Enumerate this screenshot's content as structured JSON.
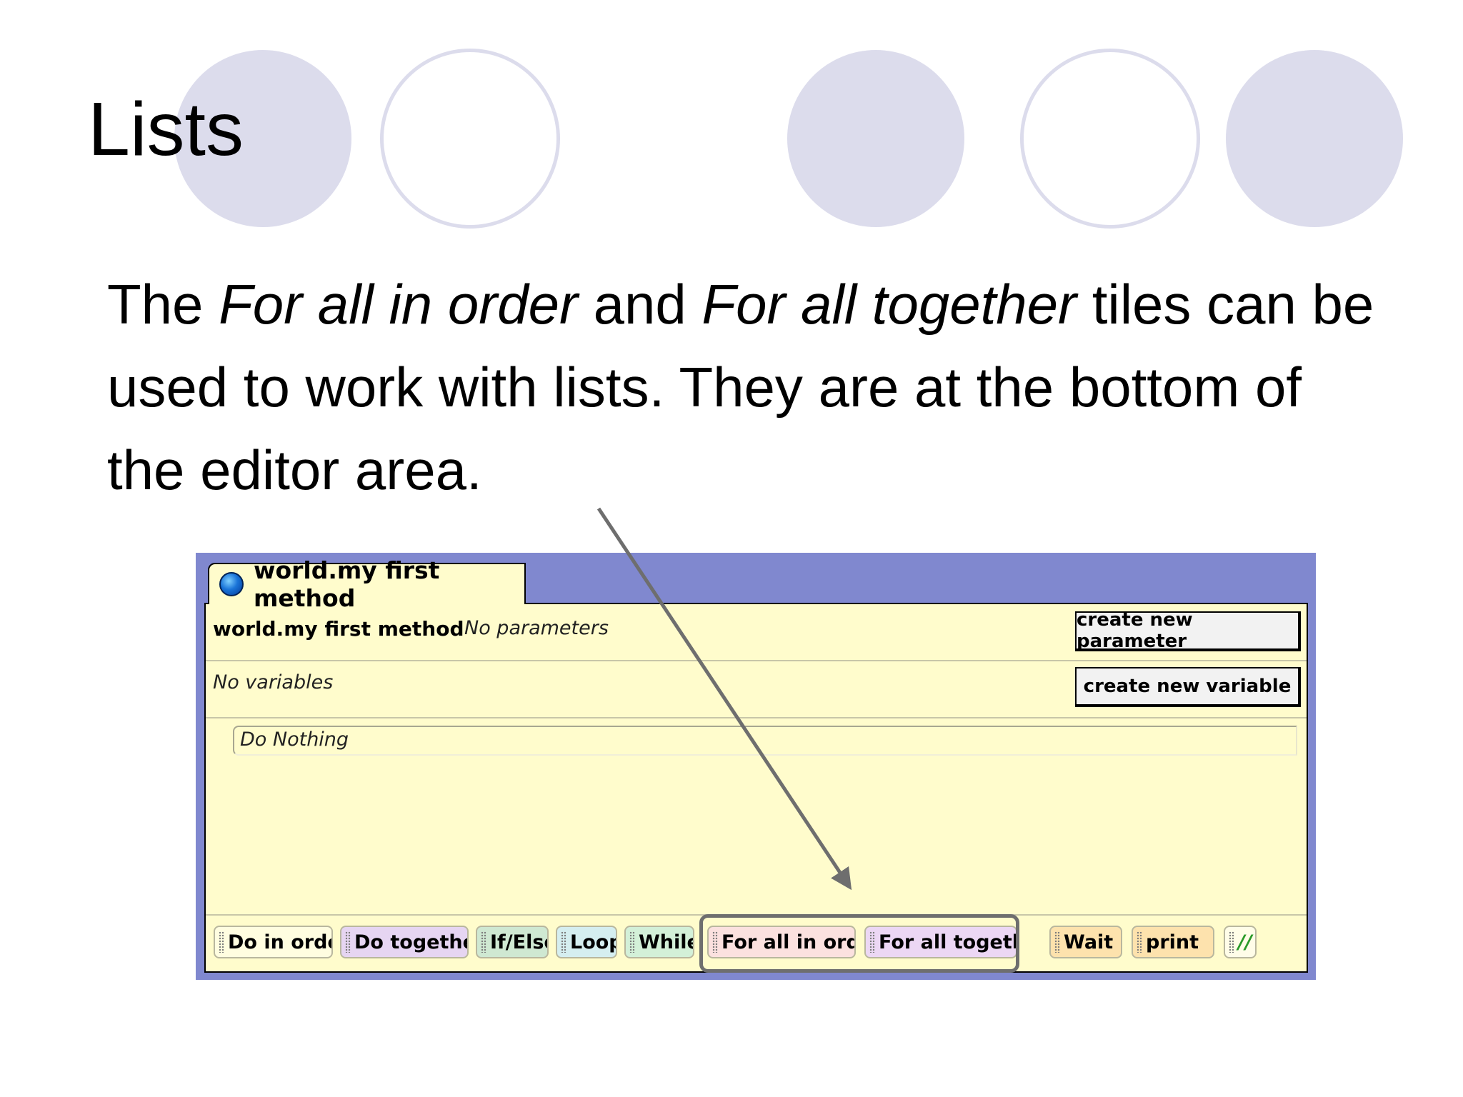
{
  "slide": {
    "title": "Lists",
    "body": {
      "part1": "The ",
      "em1": "For all in order",
      "part2": " and ",
      "em2": "For all together",
      "part3": " tiles can be used to work with lists.  They are at the bottom of the editor area."
    }
  },
  "editor": {
    "tab_label": "world.my first method",
    "method_name": "world.my first method",
    "no_parameters": "No parameters",
    "no_variables": "No variables",
    "create_parameter_label": "create new parameter",
    "create_variable_label": "create new variable",
    "do_nothing": "Do Nothing",
    "tiles": [
      {
        "label": "Do in order",
        "color": "#fffde0"
      },
      {
        "label": "Do together",
        "color": "#e6d5f2"
      },
      {
        "label": "If/Else",
        "color": "#cfe8d2"
      },
      {
        "label": "Loop",
        "color": "#d5eef0"
      },
      {
        "label": "While",
        "color": "#d3f0d8"
      },
      {
        "label": "For all in order",
        "color": "#fbe1df"
      },
      {
        "label": "For all together",
        "color": "#ecd7f4"
      },
      {
        "label": "Wait",
        "color": "#fde2ad"
      },
      {
        "label": "print",
        "color": "#fde2ad"
      },
      {
        "label": "//",
        "color": "#fffde8"
      }
    ]
  },
  "colors": {
    "decor_circle": "#dcdcec",
    "editor_frame": "#8088cf",
    "editor_panel": "#fffccc",
    "arrow": "#6e6e6e"
  }
}
